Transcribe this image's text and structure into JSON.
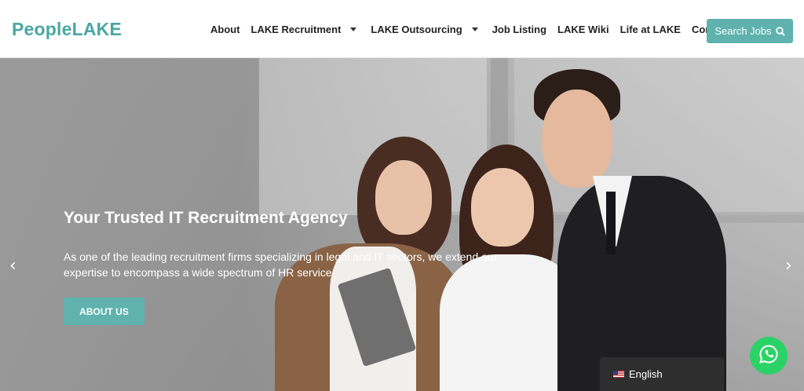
{
  "header": {
    "logo_prefix": "People",
    "logo_suffix": "LAKE",
    "nav": [
      {
        "label": "About"
      },
      {
        "label": "LAKE Recruitment"
      },
      {
        "label": "LAKE Outsourcing"
      },
      {
        "label": "Job Listing"
      },
      {
        "label": "LAKE Wiki"
      },
      {
        "label": "Life at LAKE"
      },
      {
        "label": "Contact"
      }
    ],
    "search_label": "Search Jobs"
  },
  "hero": {
    "title": "Your Trusted IT Recruitment Agency",
    "text": "As one of the leading recruitment firms specializing in legal and IT sectors, we extend our expertise to encompass a wide spectrum of HR service",
    "button_label": "ABOUT US",
    "prev_arrow": "‹",
    "next_arrow": "›"
  },
  "language": {
    "label": "English",
    "flag": "us-flag-icon"
  },
  "colors": {
    "accent": "#5fb2ae",
    "whatsapp": "#2bd366"
  }
}
